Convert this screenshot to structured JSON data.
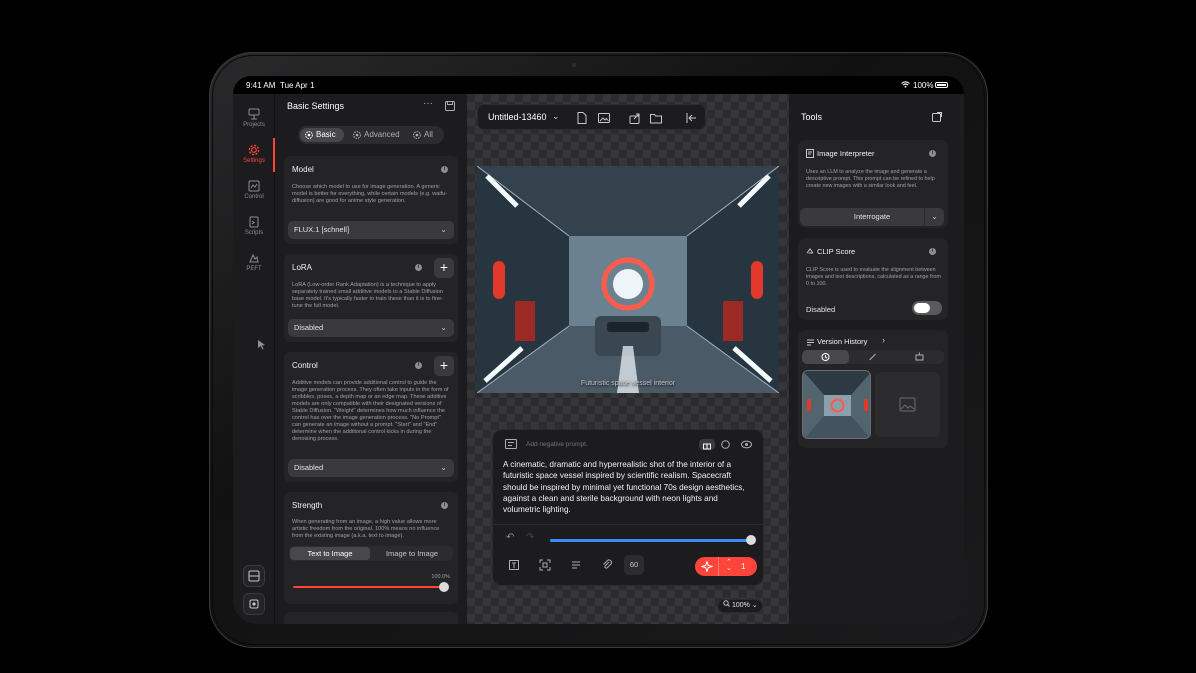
{
  "status_bar": {
    "time": "9:41 AM",
    "date": "Tue Apr 1",
    "battery": "100%"
  },
  "rail": {
    "items": [
      {
        "label": "Projects",
        "icon": "projects-icon"
      },
      {
        "label": "Settings",
        "icon": "settings-icon",
        "active": true
      },
      {
        "label": "Control",
        "icon": "control-icon"
      },
      {
        "label": "Scripts",
        "icon": "scripts-icon"
      },
      {
        "label": "PEFT",
        "icon": "peft-icon"
      }
    ]
  },
  "settings": {
    "title": "Basic Settings",
    "tabs": [
      "Basic",
      "Advanced",
      "All"
    ],
    "model": {
      "title": "Model",
      "description": "Choose which model to use for image generation. A generic model is better for everything, while certain models (e.g. waifu-diffusion) are good for anime style generation.",
      "value": "FLUX.1 [schnell]"
    },
    "lora": {
      "title": "LoRA",
      "description": "LoRA (Low-order Rank Adaptation) is a technique to apply separately trained small additive models to a Stable Diffusion base model. It's typically faster to train these than it is to fine-tune the full model.",
      "value": "Disabled"
    },
    "control": {
      "title": "Control",
      "description": "Additive models can provide additional control to guide the image generation process. They often take inputs in the form of scribbles, poses, a depth map or an edge map. These additive models are only compatible with their designated versions of Stable Diffusion. \"Weight\" determines how much influence the control has over the image generation process. \"No Prompt\" can generate an image without a prompt. \"Start\" and \"End\" determine when the additional control kicks in during the denoising process.",
      "value": "Disabled"
    },
    "strength": {
      "title": "Strength",
      "description": "When generating from an image, a high value allows more artistic freedom from the original. 100% means no influence from the existing image (a.k.a. text to image).",
      "modes": [
        "Text to Image",
        "Image to Image"
      ],
      "value_label": "100.0%",
      "value": 1.0
    }
  },
  "canvas": {
    "project_title": "Untitled-13460",
    "render_caption": "Futuristic space vessel interior",
    "negative_placeholder": "Add negative prompt.",
    "prompt_text": "A cinematic, dramatic and hyperrealistic shot of the interior of a futuristic space vessel inspired by scientific realism. Spacecraft should be inspired by minimal yet functional 70s design aesthetics, against a clean and sterile background with neon lights and volumetric lighting.",
    "progress": 1.0,
    "steps": "60",
    "generate_count": "1",
    "zoom": "100%"
  },
  "tools": {
    "title": "Tools",
    "interpreter": {
      "title": "Image Interpreter",
      "description": "Uses an LLM to analyze the image and generate a descriptive prompt. This prompt can be refined to help create new images with a similar look and feel.",
      "button": "Interrogate"
    },
    "clip": {
      "title": "CLIP Score",
      "description": "CLIP Score is used to evaluate the alignment between images and text descriptions, calculated as a range from 0 to 100.",
      "value": "Disabled"
    },
    "history": {
      "title": "Version History"
    }
  },
  "colors": {
    "accent": "#ff453a",
    "slider": "#3a8dff",
    "panel": "#1c1c1e",
    "card": "#242426"
  }
}
